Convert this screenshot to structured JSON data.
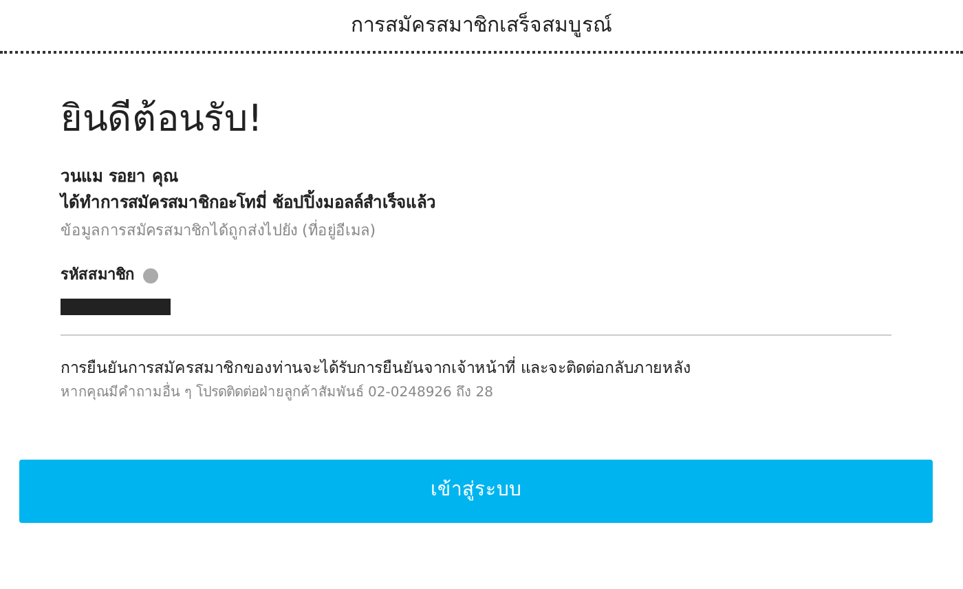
{
  "header": {
    "title": "การสมัครสมาชิกเสร็จสมบูรณ์"
  },
  "welcome": {
    "heading": "ยินดีต้อนรับ!",
    "name_line": "วนแม รอยา คุณ",
    "message": "ได้ทำการสมัครสมาชิกอะโทมี่ ช้อปปิ้งมอลล์สำเร็จแล้ว",
    "note": "ข้อมูลการสมัครสมาชิกได้ถูกส่งไปยัง (ที่อยู่อีเมล)"
  },
  "member_id": {
    "label": "รหัสสมาชิก"
  },
  "confirmation": {
    "text": "การยืนยันการสมัครสมาชิกของท่านจะได้รับการยืนยันจากเจ้าหน้าที่ และจะติดต่อกลับภายหลัง",
    "contact": "หากคุณมีคำถามอื่น ๆ โปรดติดต่อฝ่ายลูกค้าสัมพันธ์ 02-0248926 ถึง 28"
  },
  "login_button": {
    "label": "เข้าสู่ระบบ"
  }
}
